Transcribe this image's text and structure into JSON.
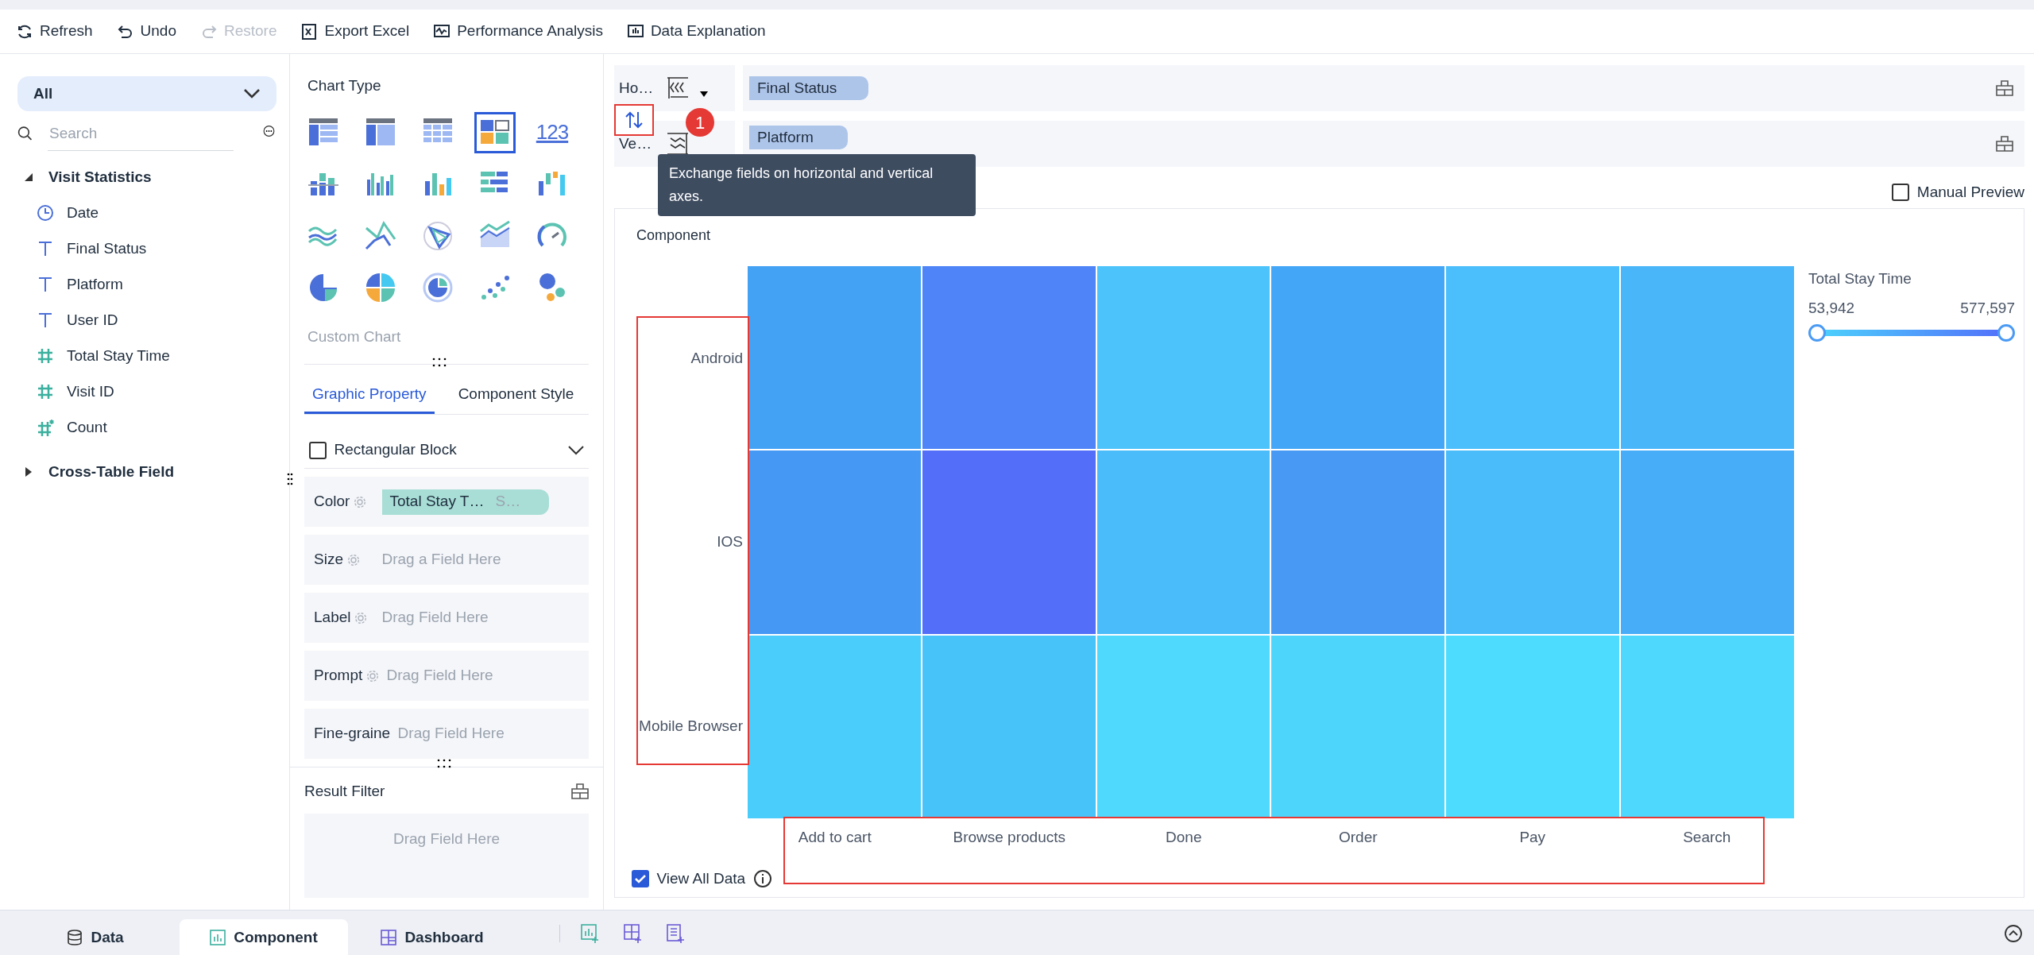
{
  "toolbar": [
    {
      "kind": "refresh",
      "label": "Refresh",
      "disabled": false
    },
    {
      "kind": "undo",
      "label": "Undo",
      "disabled": false
    },
    {
      "kind": "redo",
      "label": "Restore",
      "disabled": true
    },
    {
      "kind": "excel",
      "label": "Export Excel",
      "disabled": false
    },
    {
      "kind": "performance",
      "label": "Performance Analysis",
      "disabled": false
    },
    {
      "kind": "explain",
      "label": "Data Explanation",
      "disabled": false
    }
  ],
  "fields_panel": {
    "dropdown": "All",
    "search": {
      "placeholder": "Search"
    },
    "groups": [
      {
        "label": "Visit Statistics",
        "expanded": true,
        "children": [
          {
            "kind": "date",
            "label": "Date"
          },
          {
            "kind": "text",
            "label": "Final Status"
          },
          {
            "kind": "text",
            "label": "Platform"
          },
          {
            "kind": "text",
            "label": "User ID"
          },
          {
            "kind": "number",
            "label": "Total Stay Time"
          },
          {
            "kind": "number",
            "label": "Visit ID"
          },
          {
            "kind": "count",
            "label": "Count"
          }
        ]
      },
      {
        "label": "Cross-Table Field",
        "expanded": false
      }
    ]
  },
  "chart_panel": {
    "title": "Chart Type",
    "chart_types": [
      {
        "kind": "table",
        "selected": false
      },
      {
        "kind": "group-table",
        "selected": false
      },
      {
        "kind": "detail-table",
        "selected": false
      },
      {
        "kind": "block",
        "selected": true
      },
      {
        "kind": "number",
        "label": "123",
        "selected": false
      },
      {
        "kind": "stacked-bar",
        "selected": false
      },
      {
        "kind": "grouped-bar",
        "selected": false
      },
      {
        "kind": "bar",
        "selected": false
      },
      {
        "kind": "hbar",
        "selected": false
      },
      {
        "kind": "waterfall",
        "selected": false
      },
      {
        "kind": "line",
        "selected": false
      },
      {
        "kind": "zigzag",
        "selected": false
      },
      {
        "kind": "radar",
        "selected": false
      },
      {
        "kind": "area",
        "selected": false
      },
      {
        "kind": "gauge",
        "selected": false
      },
      {
        "kind": "pie",
        "selected": false
      },
      {
        "kind": "multi-pie",
        "selected": false
      },
      {
        "kind": "donut",
        "selected": false
      },
      {
        "kind": "scatter",
        "selected": false
      },
      {
        "kind": "bubble",
        "selected": false
      }
    ],
    "custom_chart": "Custom Chart",
    "tabs": [
      {
        "label": "Graphic Property",
        "selected": true
      },
      {
        "label": "Component Style",
        "selected": false
      }
    ],
    "mark_type": {
      "label": "Rectangular Block",
      "checked": false
    },
    "properties": [
      {
        "label": "Color",
        "field": "Total Stay T…",
        "suffix": "S…"
      },
      {
        "label": "Size",
        "placeholder": "Drag a Field Here"
      },
      {
        "label": "Label",
        "placeholder": "Drag Field Here"
      },
      {
        "label": "Prompt",
        "placeholder": "Drag Field Here"
      },
      {
        "label": "Fine-graine",
        "placeholder": "Drag Field Here"
      }
    ],
    "result_filter": {
      "title": "Result Filter",
      "placeholder": "Drag Field Here"
    }
  },
  "axes": [
    {
      "label": "Ho…",
      "field": "Final Status"
    },
    {
      "label": "Ve…",
      "field": "Platform"
    }
  ],
  "swap": {
    "highlighted": true,
    "badge": "1",
    "tooltip": "Exchange fields on horizontal and vertical axes."
  },
  "manual_preview": {
    "label": "Manual Preview",
    "checked": false
  },
  "component": {
    "title": "Component",
    "y_labels": {
      "highlighted": true,
      "items": [
        "Android",
        "IOS",
        "Mobile Browser"
      ]
    },
    "x_labels": {
      "highlighted": true,
      "items": [
        "Add to cart",
        "Browse products",
        "Done",
        "Order",
        "Pay",
        "Search"
      ]
    },
    "rows": [
      {
        "cells": [
          {
            "color": "#44a2f5"
          },
          {
            "color": "#4e84f7"
          },
          {
            "color": "#4cc3fb"
          },
          {
            "color": "#44a6f6"
          },
          {
            "color": "#4bbffb"
          },
          {
            "color": "#4ab6fa"
          }
        ]
      },
      {
        "cells": [
          {
            "color": "#4598f4"
          },
          {
            "color": "#536ffa"
          },
          {
            "color": "#4bbcfa"
          },
          {
            "color": "#4799f3"
          },
          {
            "color": "#4bbcfa"
          },
          {
            "color": "#48adf8"
          }
        ]
      },
      {
        "cells": [
          {
            "color": "#4bcdfb"
          },
          {
            "color": "#48c3f9"
          },
          {
            "color": "#4ed9fd"
          },
          {
            "color": "#4dd5fc"
          },
          {
            "color": "#4edcfe"
          },
          {
            "color": "#4ed8fd"
          }
        ]
      }
    ],
    "legend": {
      "title": "Total Stay Time",
      "min": "53,942",
      "max": "577,597",
      "handles": [
        {
          "level": 0
        },
        {
          "level": 1
        }
      ]
    },
    "view_all": {
      "label": "View All Data",
      "checked": true
    }
  },
  "bottom_tabs": [
    {
      "kind": "data",
      "label": "Data",
      "selected": false
    },
    {
      "kind": "component",
      "label": "Component",
      "selected": true
    },
    {
      "kind": "dashboard",
      "label": "Dashboard",
      "selected": false
    }
  ]
}
